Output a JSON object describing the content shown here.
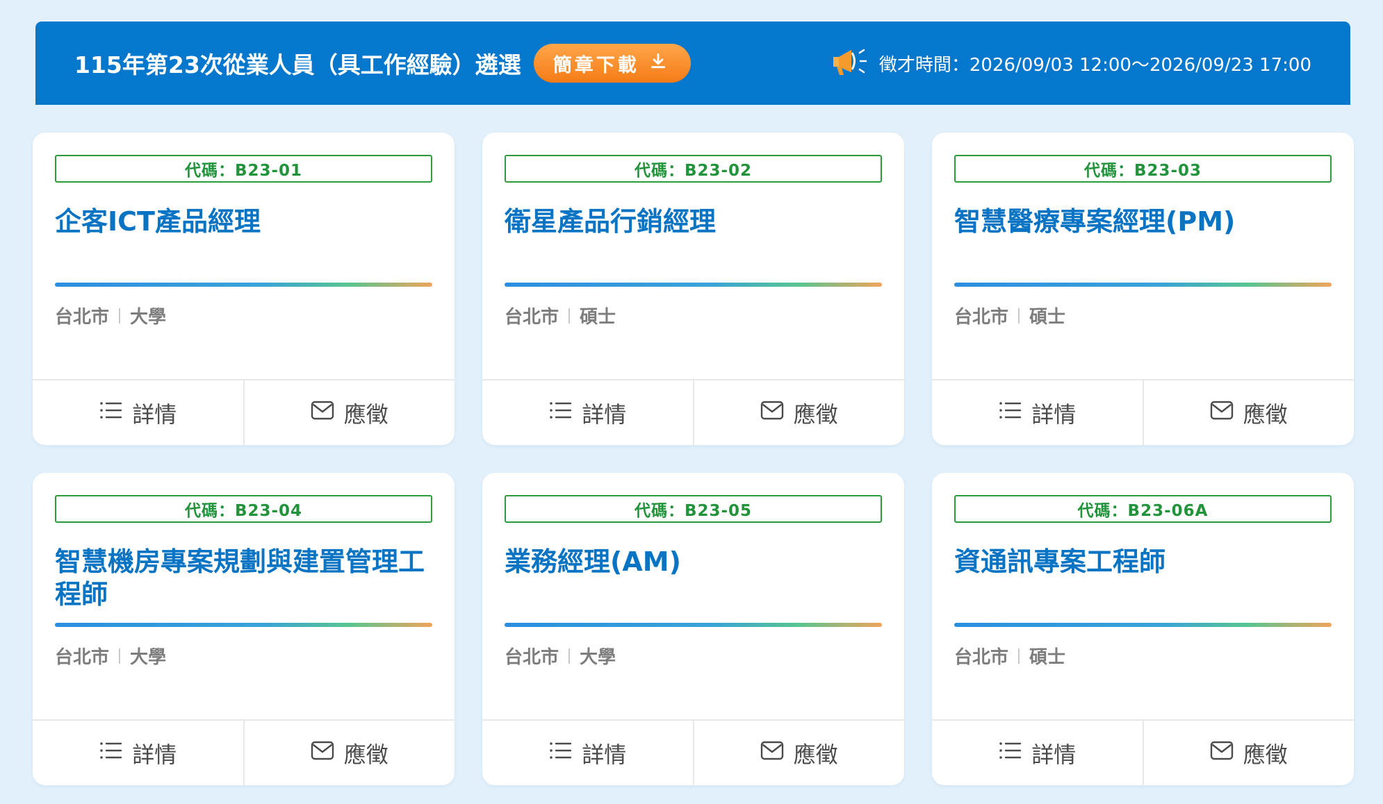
{
  "header": {
    "title": "115年第23次從業人員（具工作經驗）遴選",
    "download_label": "簡章下載",
    "recruit_time": "徵才時間：2026/09/03 12:00～2026/09/23 17:00"
  },
  "actions": {
    "detail_label": "詳情",
    "apply_label": "應徵"
  },
  "jobs": [
    {
      "code": "代碼：B23-01",
      "title": "企客ICT產品經理",
      "location": "台北市",
      "education": "大學"
    },
    {
      "code": "代碼：B23-02",
      "title": "衛星產品行銷經理",
      "location": "台北市",
      "education": "碩士"
    },
    {
      "code": "代碼：B23-03",
      "title": "智慧醫療專案經理(PM)",
      "location": "台北市",
      "education": "碩士"
    },
    {
      "code": "代碼：B23-04",
      "title": "智慧機房專案規劃與建置管理工程師",
      "location": "台北市",
      "education": "大學"
    },
    {
      "code": "代碼：B23-05",
      "title": "業務經理(AM)",
      "location": "台北市",
      "education": "大學"
    },
    {
      "code": "代碼：B23-06A",
      "title": "資通訊專案工程師",
      "location": "台北市",
      "education": "碩士"
    }
  ],
  "colors": {
    "header_bg": "#0578cd",
    "download_btn": "#f57c16",
    "code_green": "#21933a",
    "title_blue": "#0a74c4"
  },
  "icons": {
    "download": "download-icon",
    "megaphone": "megaphone-icon",
    "detail": "list-icon",
    "apply": "mail-icon"
  }
}
